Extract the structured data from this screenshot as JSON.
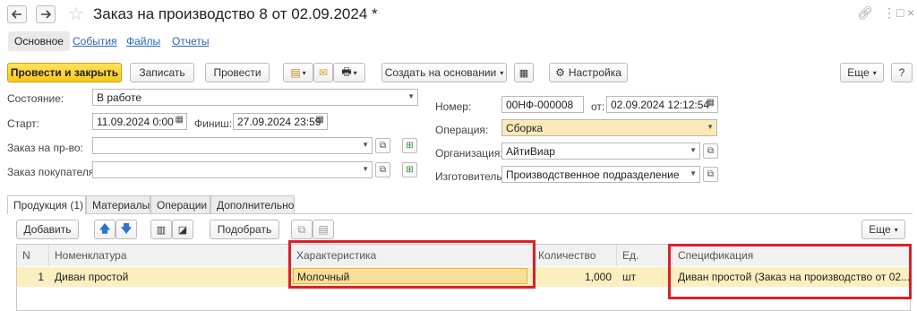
{
  "window": {
    "title": "Заказ на производство 8 от 02.09.2024 *"
  },
  "icons": {
    "back": "arrow-left-icon",
    "forward": "arrow-right-icon",
    "favorite": "star-icon",
    "link": "link-icon",
    "more": "more-vertical-icon",
    "maximize": "maximize-icon",
    "close": "close-icon"
  },
  "subnav": {
    "main": "Основное",
    "events": "События",
    "files": "Файлы",
    "reports": "Отчеты"
  },
  "toolbar": {
    "post_close": "Провести и закрыть",
    "save": "Записать",
    "post": "Провести",
    "create_based": "Создать на основании",
    "settings": "Настройка",
    "more": "Еще",
    "help": "?"
  },
  "form": {
    "state_label": "Состояние:",
    "state_value": "В работе",
    "start_label": "Старт:",
    "start_value": "11.09.2024  0:00",
    "finish_label": "Финиш:",
    "finish_value": "27.09.2024 23:59",
    "order_label": "Заказ на пр-во:",
    "order_value": "",
    "customer_label": "Заказ покупателя:",
    "customer_value": "",
    "number_label": "Номер:",
    "number_value": "00НФ-000008",
    "from_label": "от:",
    "from_value": "02.09.2024 12:12:54",
    "operation_label": "Операция:",
    "operation_value": "Сборка",
    "org_label": "Организация:",
    "org_value": "АйтиВиар",
    "maker_label": "Изготовитель:",
    "maker_value": "Производственное подразделение"
  },
  "tabs": [
    "Продукция (1)",
    "Материалы",
    "Операции",
    "Дополнительно"
  ],
  "table_toolbar": {
    "add": "Добавить",
    "pick": "Подобрать",
    "more": "Еще"
  },
  "table": {
    "columns": [
      "N",
      "Номенклатура",
      "Характеристика",
      "Количество",
      "Ед.",
      "Спецификация"
    ],
    "rows": [
      [
        "1",
        "Диван простой",
        "Молочный",
        "1,000",
        "шт",
        "Диван простой (Заказ на производство  от 02...."
      ]
    ]
  },
  "colors": {
    "primary": "#f8c81b",
    "highlight_row": "#fbeebf",
    "link": "#2a66b8",
    "annotation": "#d9212b"
  }
}
